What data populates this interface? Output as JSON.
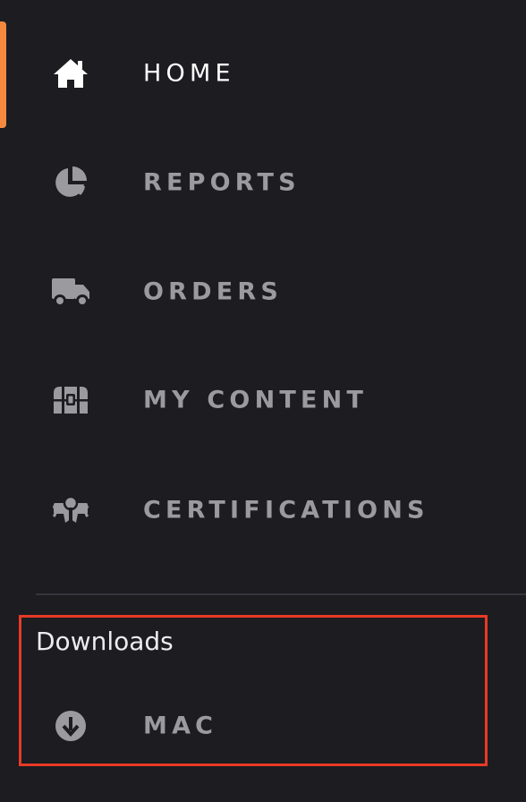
{
  "accent_color": "#f58a3f",
  "highlight_color": "#e83a25",
  "nav": {
    "items": [
      {
        "label": "HOME",
        "icon": "home-icon",
        "active": true
      },
      {
        "label": "REPORTS",
        "icon": "pie-chart-icon",
        "active": false
      },
      {
        "label": "ORDERS",
        "icon": "truck-icon",
        "active": false
      },
      {
        "label": "MY CONTENT",
        "icon": "treasure-chest-icon",
        "active": false
      },
      {
        "label": "CERTIFICATIONS",
        "icon": "certificate-icon",
        "active": false
      }
    ]
  },
  "downloads": {
    "title": "Downloads",
    "items": [
      {
        "label": "MAC",
        "icon": "download-circle-icon"
      }
    ]
  }
}
